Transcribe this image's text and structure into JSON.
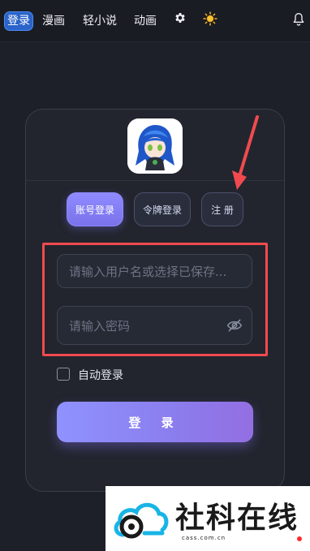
{
  "nav": {
    "items": [
      "登录",
      "漫画",
      "轻小说",
      "动画"
    ],
    "active_index": 0
  },
  "tabs": [
    "账号登录",
    "令牌登录",
    "注 册"
  ],
  "form": {
    "username_placeholder": "请输入用户名或选择已保存...",
    "password_placeholder": "请输入密码",
    "auto_login_label": "自动登录",
    "auto_login_checked": false,
    "submit_label": "登 录"
  },
  "watermark": {
    "title": "社科在线",
    "url": "cass.com.cn"
  },
  "colors": {
    "accent": "#8b7ded",
    "highlight_box": "#f04a4f",
    "nav_active": "#2a63c9"
  },
  "icons": {
    "settings": "gear-icon",
    "theme": "sun-icon",
    "notifications": "bell-icon",
    "password_visibility": "eye-off-icon"
  }
}
